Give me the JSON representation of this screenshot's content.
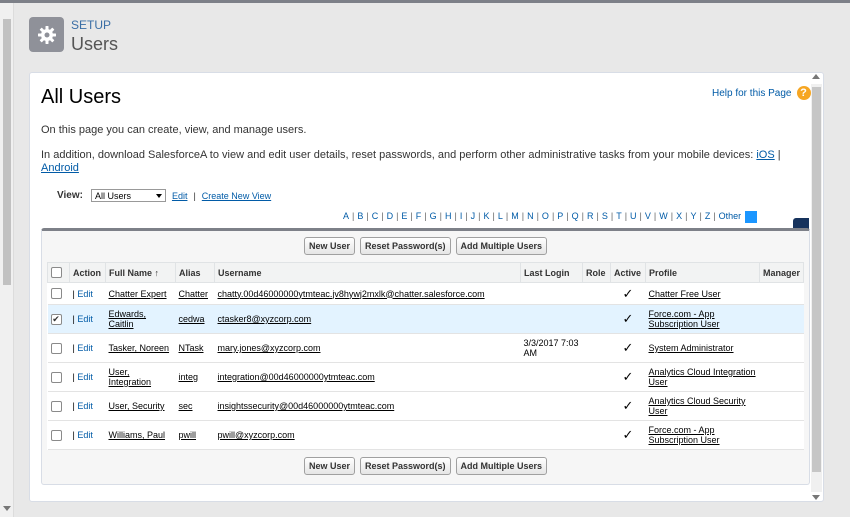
{
  "header": {
    "section": "SETUP",
    "title": "Users"
  },
  "page": {
    "title": "All Users",
    "help_link": "Help for this Page",
    "intro": "On this page you can create, view, and manage users.",
    "intro2_prefix": "In addition, download SalesforceA to view and edit user details, reset passwords, and perform other administrative tasks from your mobile devices: ",
    "ios_link": "iOS",
    "intro2_sep": " | ",
    "android_link": "Android"
  },
  "view": {
    "label": "View:",
    "selected": "All Users",
    "edit_link": "Edit",
    "sep": "|",
    "create_link": "Create New View"
  },
  "alphabet": [
    "A",
    "B",
    "C",
    "D",
    "E",
    "F",
    "G",
    "H",
    "I",
    "J",
    "K",
    "L",
    "M",
    "N",
    "O",
    "P",
    "Q",
    "R",
    "S",
    "T",
    "U",
    "V",
    "W",
    "X",
    "Y",
    "Z",
    "Other"
  ],
  "buttons": {
    "new_user": "New User",
    "reset_password": "Reset Password(s)",
    "add_multiple": "Add Multiple Users"
  },
  "table": {
    "columns": {
      "action": "Action",
      "full_name": "Full Name",
      "sort_arrow": "↑",
      "alias": "Alias",
      "username": "Username",
      "last_login": "Last Login",
      "role": "Role",
      "active": "Active",
      "profile": "Profile",
      "manager": "Manager"
    },
    "edit_label": "Edit",
    "action_sep": "|",
    "active_mark": "✓",
    "rows": [
      {
        "name": "Chatter Expert",
        "alias": "Chatter",
        "username": "chatty.00d46000000ytmteac.jv8hywj2mxlk@chatter.salesforce.com",
        "last_login": "",
        "profile": "Chatter Free User",
        "checked": false
      },
      {
        "name": "Edwards, Caitlin",
        "alias": "cedwa",
        "username": "ctasker8@xyzcorp.com",
        "last_login": "",
        "profile": "Force.com - App Subscription User",
        "checked": true
      },
      {
        "name": "Tasker, Noreen",
        "alias": "NTask",
        "username": "mary.jones@xyzcorp.com",
        "last_login": "3/3/2017 7:03 AM",
        "profile": "System Administrator",
        "checked": false
      },
      {
        "name": "User, Integration",
        "alias": "integ",
        "username": "integration@00d46000000ytmteac.com",
        "last_login": "",
        "profile": "Analytics Cloud Integration User",
        "checked": false
      },
      {
        "name": "User, Security",
        "alias": "sec",
        "username": "insightssecurity@00d46000000ytmteac.com",
        "last_login": "",
        "profile": "Analytics Cloud Security User",
        "checked": false
      },
      {
        "name": "Williams, Paul",
        "alias": "pwill",
        "username": "pwill@xyzcorp.com",
        "last_login": "",
        "profile": "Force.com - App Subscription User",
        "checked": false
      }
    ]
  }
}
